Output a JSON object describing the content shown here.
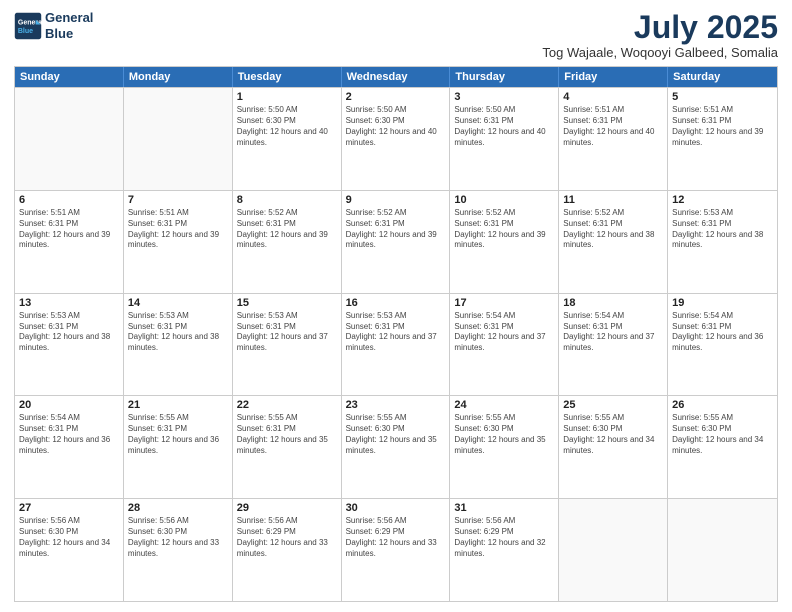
{
  "logo": {
    "line1": "General",
    "line2": "Blue"
  },
  "title": "July 2025",
  "subtitle": "Tog Wajaale, Woqooyi Galbeed, Somalia",
  "days_header": [
    "Sunday",
    "Monday",
    "Tuesday",
    "Wednesday",
    "Thursday",
    "Friday",
    "Saturday"
  ],
  "weeks": [
    [
      {
        "day": "",
        "sunrise": "",
        "sunset": "",
        "daylight": "",
        "empty": true
      },
      {
        "day": "",
        "sunrise": "",
        "sunset": "",
        "daylight": "",
        "empty": true
      },
      {
        "day": "1",
        "sunrise": "Sunrise: 5:50 AM",
        "sunset": "Sunset: 6:30 PM",
        "daylight": "Daylight: 12 hours and 40 minutes."
      },
      {
        "day": "2",
        "sunrise": "Sunrise: 5:50 AM",
        "sunset": "Sunset: 6:30 PM",
        "daylight": "Daylight: 12 hours and 40 minutes."
      },
      {
        "day": "3",
        "sunrise": "Sunrise: 5:50 AM",
        "sunset": "Sunset: 6:31 PM",
        "daylight": "Daylight: 12 hours and 40 minutes."
      },
      {
        "day": "4",
        "sunrise": "Sunrise: 5:51 AM",
        "sunset": "Sunset: 6:31 PM",
        "daylight": "Daylight: 12 hours and 40 minutes."
      },
      {
        "day": "5",
        "sunrise": "Sunrise: 5:51 AM",
        "sunset": "Sunset: 6:31 PM",
        "daylight": "Daylight: 12 hours and 39 minutes."
      }
    ],
    [
      {
        "day": "6",
        "sunrise": "Sunrise: 5:51 AM",
        "sunset": "Sunset: 6:31 PM",
        "daylight": "Daylight: 12 hours and 39 minutes."
      },
      {
        "day": "7",
        "sunrise": "Sunrise: 5:51 AM",
        "sunset": "Sunset: 6:31 PM",
        "daylight": "Daylight: 12 hours and 39 minutes."
      },
      {
        "day": "8",
        "sunrise": "Sunrise: 5:52 AM",
        "sunset": "Sunset: 6:31 PM",
        "daylight": "Daylight: 12 hours and 39 minutes."
      },
      {
        "day": "9",
        "sunrise": "Sunrise: 5:52 AM",
        "sunset": "Sunset: 6:31 PM",
        "daylight": "Daylight: 12 hours and 39 minutes."
      },
      {
        "day": "10",
        "sunrise": "Sunrise: 5:52 AM",
        "sunset": "Sunset: 6:31 PM",
        "daylight": "Daylight: 12 hours and 39 minutes."
      },
      {
        "day": "11",
        "sunrise": "Sunrise: 5:52 AM",
        "sunset": "Sunset: 6:31 PM",
        "daylight": "Daylight: 12 hours and 38 minutes."
      },
      {
        "day": "12",
        "sunrise": "Sunrise: 5:53 AM",
        "sunset": "Sunset: 6:31 PM",
        "daylight": "Daylight: 12 hours and 38 minutes."
      }
    ],
    [
      {
        "day": "13",
        "sunrise": "Sunrise: 5:53 AM",
        "sunset": "Sunset: 6:31 PM",
        "daylight": "Daylight: 12 hours and 38 minutes."
      },
      {
        "day": "14",
        "sunrise": "Sunrise: 5:53 AM",
        "sunset": "Sunset: 6:31 PM",
        "daylight": "Daylight: 12 hours and 38 minutes."
      },
      {
        "day": "15",
        "sunrise": "Sunrise: 5:53 AM",
        "sunset": "Sunset: 6:31 PM",
        "daylight": "Daylight: 12 hours and 37 minutes."
      },
      {
        "day": "16",
        "sunrise": "Sunrise: 5:53 AM",
        "sunset": "Sunset: 6:31 PM",
        "daylight": "Daylight: 12 hours and 37 minutes."
      },
      {
        "day": "17",
        "sunrise": "Sunrise: 5:54 AM",
        "sunset": "Sunset: 6:31 PM",
        "daylight": "Daylight: 12 hours and 37 minutes."
      },
      {
        "day": "18",
        "sunrise": "Sunrise: 5:54 AM",
        "sunset": "Sunset: 6:31 PM",
        "daylight": "Daylight: 12 hours and 37 minutes."
      },
      {
        "day": "19",
        "sunrise": "Sunrise: 5:54 AM",
        "sunset": "Sunset: 6:31 PM",
        "daylight": "Daylight: 12 hours and 36 minutes."
      }
    ],
    [
      {
        "day": "20",
        "sunrise": "Sunrise: 5:54 AM",
        "sunset": "Sunset: 6:31 PM",
        "daylight": "Daylight: 12 hours and 36 minutes."
      },
      {
        "day": "21",
        "sunrise": "Sunrise: 5:55 AM",
        "sunset": "Sunset: 6:31 PM",
        "daylight": "Daylight: 12 hours and 36 minutes."
      },
      {
        "day": "22",
        "sunrise": "Sunrise: 5:55 AM",
        "sunset": "Sunset: 6:31 PM",
        "daylight": "Daylight: 12 hours and 35 minutes."
      },
      {
        "day": "23",
        "sunrise": "Sunrise: 5:55 AM",
        "sunset": "Sunset: 6:30 PM",
        "daylight": "Daylight: 12 hours and 35 minutes."
      },
      {
        "day": "24",
        "sunrise": "Sunrise: 5:55 AM",
        "sunset": "Sunset: 6:30 PM",
        "daylight": "Daylight: 12 hours and 35 minutes."
      },
      {
        "day": "25",
        "sunrise": "Sunrise: 5:55 AM",
        "sunset": "Sunset: 6:30 PM",
        "daylight": "Daylight: 12 hours and 34 minutes."
      },
      {
        "day": "26",
        "sunrise": "Sunrise: 5:55 AM",
        "sunset": "Sunset: 6:30 PM",
        "daylight": "Daylight: 12 hours and 34 minutes."
      }
    ],
    [
      {
        "day": "27",
        "sunrise": "Sunrise: 5:56 AM",
        "sunset": "Sunset: 6:30 PM",
        "daylight": "Daylight: 12 hours and 34 minutes."
      },
      {
        "day": "28",
        "sunrise": "Sunrise: 5:56 AM",
        "sunset": "Sunset: 6:30 PM",
        "daylight": "Daylight: 12 hours and 33 minutes."
      },
      {
        "day": "29",
        "sunrise": "Sunrise: 5:56 AM",
        "sunset": "Sunset: 6:29 PM",
        "daylight": "Daylight: 12 hours and 33 minutes."
      },
      {
        "day": "30",
        "sunrise": "Sunrise: 5:56 AM",
        "sunset": "Sunset: 6:29 PM",
        "daylight": "Daylight: 12 hours and 33 minutes."
      },
      {
        "day": "31",
        "sunrise": "Sunrise: 5:56 AM",
        "sunset": "Sunset: 6:29 PM",
        "daylight": "Daylight: 12 hours and 32 minutes."
      },
      {
        "day": "",
        "sunrise": "",
        "sunset": "",
        "daylight": "",
        "empty": true
      },
      {
        "day": "",
        "sunrise": "",
        "sunset": "",
        "daylight": "",
        "empty": true
      }
    ]
  ]
}
